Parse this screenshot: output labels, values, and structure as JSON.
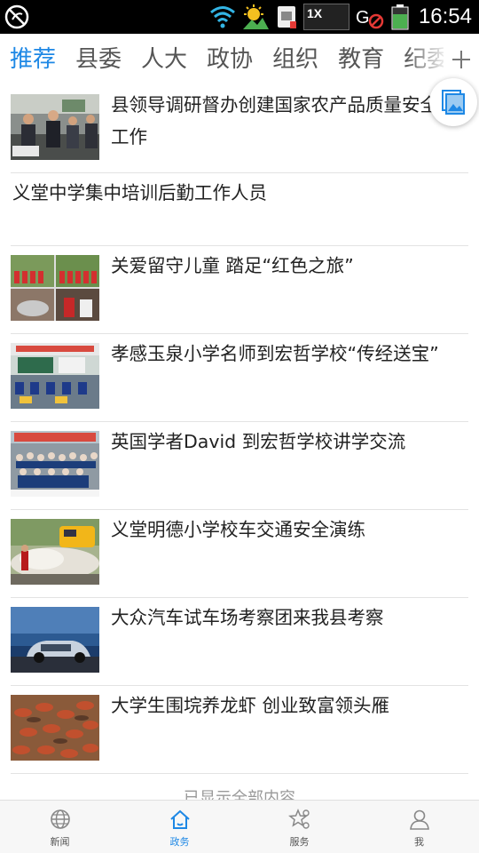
{
  "status_bar": {
    "time": "16:54",
    "speed_badge": "1X",
    "icons": [
      "no-disturb-icon",
      "wifi-icon",
      "weather-icon",
      "sim-icon",
      "speed-badge",
      "no-gps-icon",
      "battery-icon"
    ]
  },
  "tabs": [
    {
      "label": "推荐",
      "active": true
    },
    {
      "label": "县委",
      "active": false
    },
    {
      "label": "人大",
      "active": false
    },
    {
      "label": "政协",
      "active": false
    },
    {
      "label": "组织",
      "active": false
    },
    {
      "label": "教育",
      "active": false
    },
    {
      "label": "纪委",
      "active": false
    }
  ],
  "news": [
    {
      "title": "县领导调研督办创建国家农产品质量安全县工作",
      "has_image": true,
      "thumb": "meeting-photo"
    },
    {
      "title": "义堂中学集中培训后勤工作人员",
      "has_image": false
    },
    {
      "title": "关爱留守儿童 踏足“红色之旅”",
      "has_image": true,
      "thumb": "children-collage-photo"
    },
    {
      "title": "孝感玉泉小学名师到宏哲学校“传经送宝”",
      "has_image": true,
      "thumb": "classroom-photo"
    },
    {
      "title": "英国学者David 到宏哲学校讲学交流",
      "has_image": true,
      "thumb": "group-photo"
    },
    {
      "title": "义堂明德小学校车交通安全演练",
      "has_image": true,
      "thumb": "fire-drill-photo"
    },
    {
      "title": "大众汽车试车场考察团来我县考察",
      "has_image": true,
      "thumb": "car-photo"
    },
    {
      "title": "大学生围垸养龙虾 创业致富领头雁",
      "has_image": true,
      "thumb": "crayfish-photo"
    }
  ],
  "more_text": "已显示全部内容",
  "bottom_nav": [
    {
      "label": "新闻",
      "icon": "globe-icon",
      "active": false
    },
    {
      "label": "政务",
      "icon": "home-icon",
      "active": true
    },
    {
      "label": "服务",
      "icon": "service-icon",
      "active": false
    },
    {
      "label": "我",
      "icon": "person-icon",
      "active": false
    }
  ],
  "colors": {
    "accent": "#1e88e5",
    "status_bar": "#000000",
    "divider": "#e3e3e3"
  }
}
